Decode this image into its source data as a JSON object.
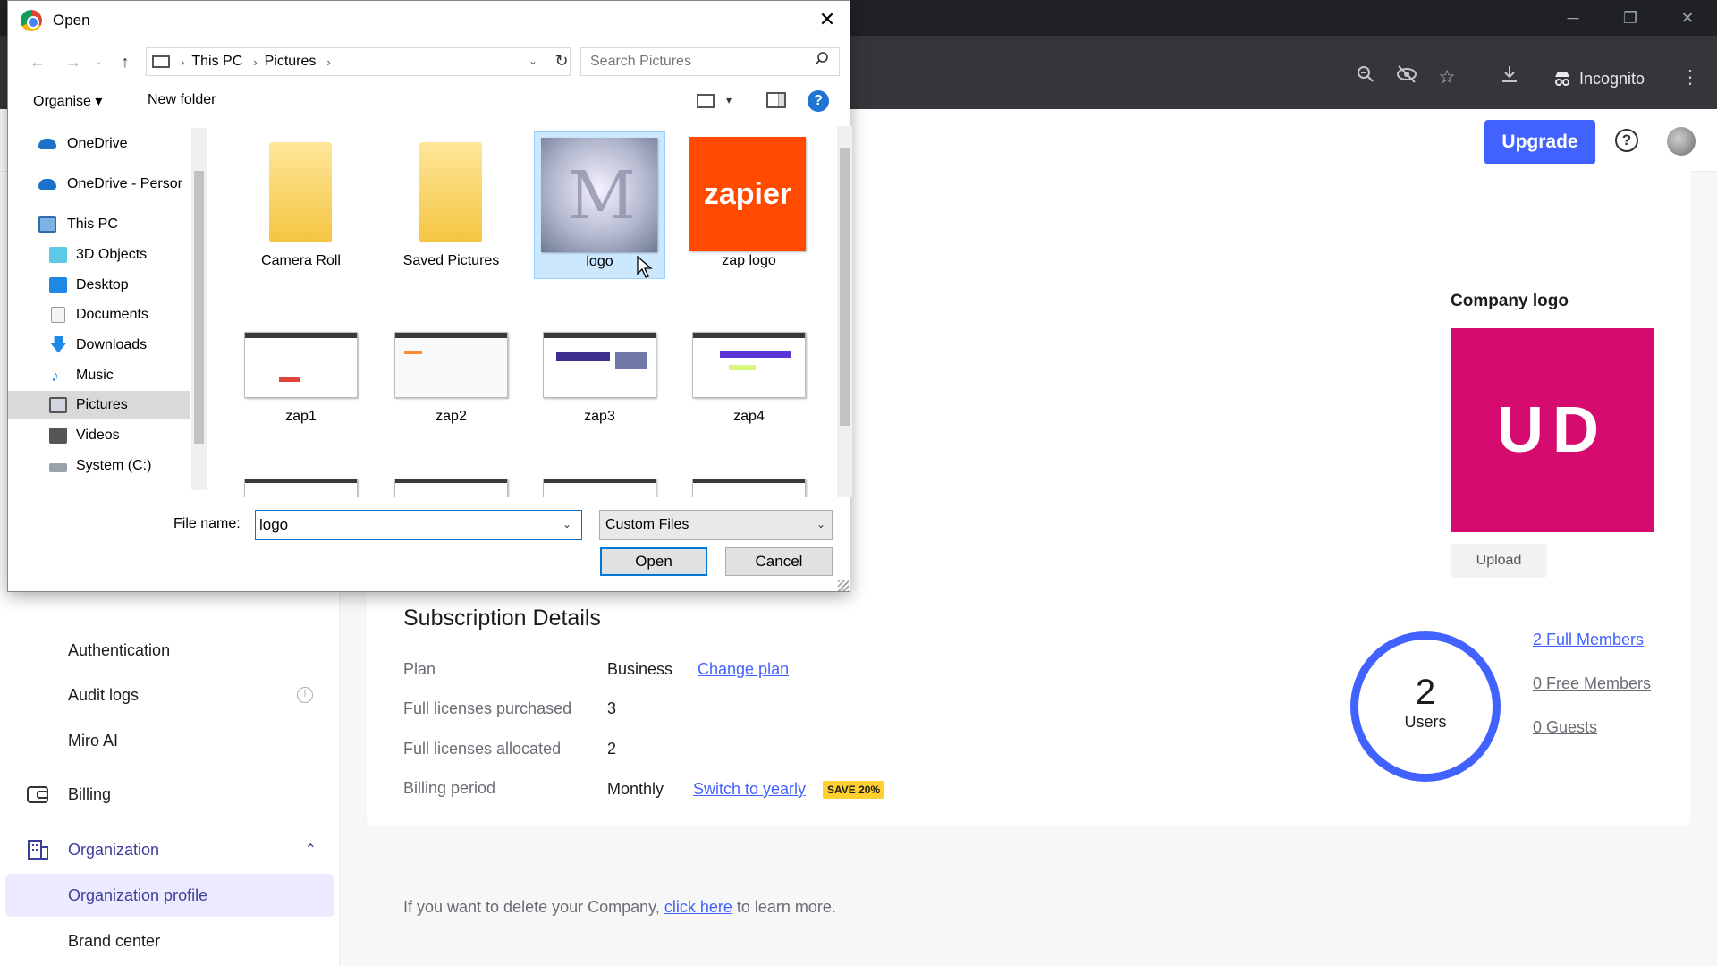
{
  "browser": {
    "incognito_label": "Incognito",
    "toolbar_icons": [
      "zoom-icon",
      "eye-off-icon",
      "star-icon",
      "download-icon",
      "more-icon"
    ]
  },
  "header": {
    "upgrade_label": "Upgrade",
    "help_icon": "?",
    "accent": "#4262ff"
  },
  "sidebar": {
    "items": [
      {
        "label": "Authentication"
      },
      {
        "label": "Audit logs",
        "info": "i"
      },
      {
        "label": "Miro AI"
      },
      {
        "label": "Billing"
      },
      {
        "label": "Organization",
        "chevron": "⌃"
      },
      {
        "label": "Organization profile"
      },
      {
        "label": "Brand center"
      }
    ]
  },
  "company": {
    "logo_title": "Company logo",
    "initials": "UD",
    "logo_color": "#d50b6f",
    "upload_label": "Upload"
  },
  "subscription": {
    "title": "Subscription Details",
    "plan_label": "Plan",
    "plan_value": "Business",
    "change_plan": "Change plan",
    "purchased_label": "Full licenses purchased",
    "purchased_value": "3",
    "allocated_label": "Full licenses allocated",
    "allocated_value": "2",
    "period_label": "Billing period",
    "period_value": "Monthly",
    "switch_yearly": "Switch to yearly",
    "save_badge": "SAVE 20%"
  },
  "users": {
    "count": "2",
    "label": "Users",
    "full_members": "2 Full Members",
    "free_members": "0 Free Members",
    "guests": "0 Guests"
  },
  "delete_note": {
    "before": "If you want to delete your Company, ",
    "link": "click here",
    "after": " to learn more."
  },
  "dialog": {
    "title": "Open",
    "close": "✕",
    "path": [
      "This PC",
      "Pictures"
    ],
    "search_placeholder": "Search Pictures",
    "organise": "Organise ▾",
    "new_folder": "New folder",
    "help": "?",
    "nav_items": [
      {
        "label": "OneDrive"
      },
      {
        "label": "OneDrive - Persor"
      },
      {
        "label": "This PC"
      },
      {
        "label": "3D Objects"
      },
      {
        "label": "Desktop"
      },
      {
        "label": "Documents"
      },
      {
        "label": "Downloads"
      },
      {
        "label": "Music"
      },
      {
        "label": "Pictures"
      },
      {
        "label": "Videos"
      },
      {
        "label": "System (C:)"
      }
    ],
    "files": [
      {
        "label": "Camera Roll"
      },
      {
        "label": "Saved Pictures"
      },
      {
        "label": "logo"
      },
      {
        "label": "zap logo",
        "thumb_text": "zapier"
      },
      {
        "label": "zap1"
      },
      {
        "label": "zap2"
      },
      {
        "label": "zap3"
      },
      {
        "label": "zap4"
      }
    ],
    "file_name_label": "File name:",
    "file_name_value": "logo",
    "file_type": "Custom Files",
    "open_label": "Open",
    "cancel_label": "Cancel"
  }
}
